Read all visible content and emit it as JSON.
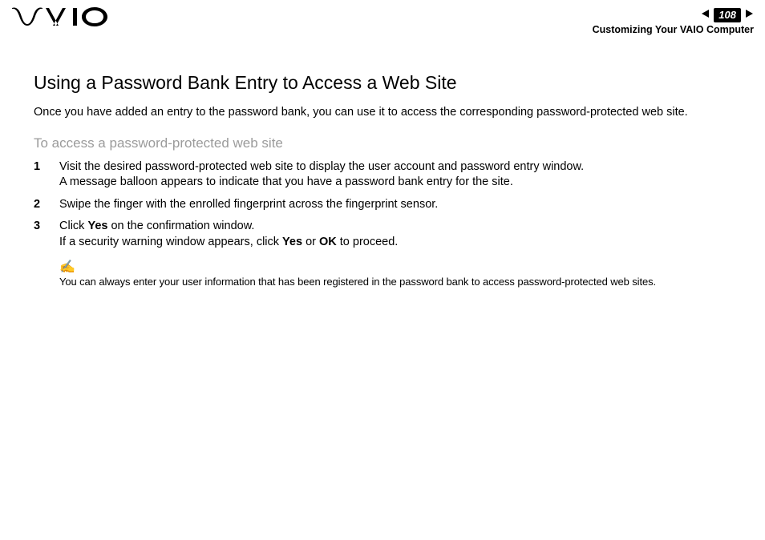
{
  "header": {
    "page_number": "108",
    "section": "Customizing Your VAIO Computer"
  },
  "content": {
    "title": "Using a Password Bank Entry to Access a Web Site",
    "intro": "Once you have added an entry to the password bank, you can use it to access the corresponding password-protected web site.",
    "sub_heading": "To access a password-protected web site",
    "steps": [
      {
        "num": "1",
        "line1": "Visit the desired password-protected web site to display the user account and password entry window.",
        "line2": "A message balloon appears to indicate that you have a password bank entry for the site."
      },
      {
        "num": "2",
        "line1": "Swipe the finger with the enrolled fingerprint across the fingerprint sensor."
      },
      {
        "num": "3",
        "line1_pre": "Click ",
        "line1_bold": "Yes",
        "line1_post": " on the confirmation window.",
        "line2_pre": "If a security warning window appears, click ",
        "line2_bold1": "Yes",
        "line2_mid": " or ",
        "line2_bold2": "OK",
        "line2_post": " to proceed."
      }
    ],
    "note": "You can always enter your user information that has been registered in the password bank to access password-protected web sites."
  }
}
